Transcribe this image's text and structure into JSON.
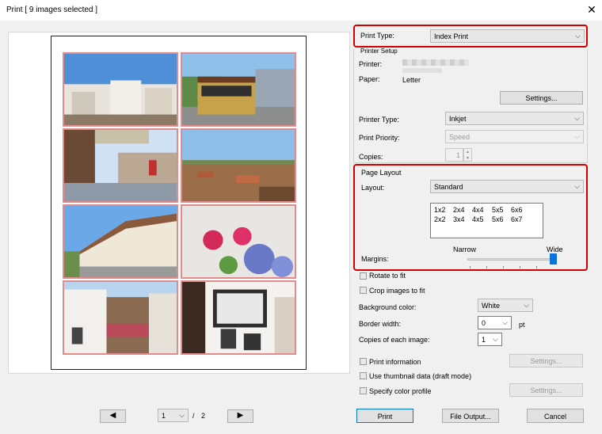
{
  "window": {
    "title": "Print [ 9 images selected ]"
  },
  "print_type": {
    "label": "Print Type:",
    "value": "Index Print"
  },
  "printer_setup": {
    "group_label": "Printer Setup",
    "printer_label": "Printer:",
    "paper_label": "Paper:",
    "paper_value": "Letter",
    "settings_button": "Settings...",
    "printer_type_label": "Printer Type:",
    "printer_type_value": "Inkjet",
    "print_priority_label": "Print Priority:",
    "print_priority_value": "Speed",
    "copies_label": "Copies:",
    "copies_value": "1"
  },
  "page_layout": {
    "group_label": "Page Layout",
    "layout_label": "Layout:",
    "layout_value": "Standard",
    "grid_row1": [
      "1x2",
      "2x4",
      "4x4",
      "5x5",
      "6x6"
    ],
    "grid_row2": [
      "2x2",
      "3x4",
      "4x5",
      "5x6",
      "6x7"
    ],
    "narrow_label": "Narrow",
    "wide_label": "Wide",
    "margins_label": "Margins:"
  },
  "options": {
    "rotate_label": "Rotate to fit",
    "crop_label": "Crop images to fit",
    "background_label": "Background color:",
    "background_value": "White",
    "border_label": "Border width:",
    "border_value": "0",
    "border_unit": "pt",
    "copies_each_label": "Copies of each image:",
    "copies_each_value": "1",
    "print_info_label": "Print information",
    "print_info_settings": "Settings...",
    "thumbnail_label": "Use thumbnail data (draft mode)",
    "color_profile_label": "Specify color profile",
    "color_profile_settings": "Settings..."
  },
  "pagination": {
    "current": "1",
    "separator": "/",
    "total": "2"
  },
  "buttons": {
    "print": "Print",
    "file_output": "File Output...",
    "cancel": "Cancel"
  }
}
